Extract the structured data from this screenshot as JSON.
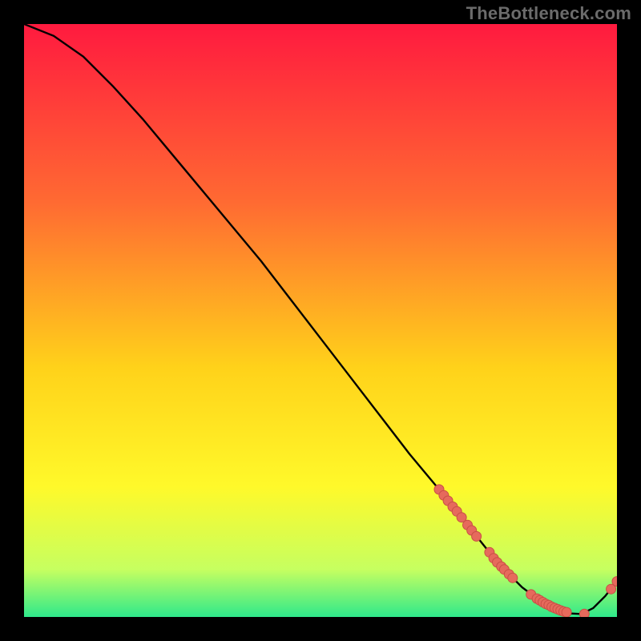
{
  "watermark": "TheBottleneck.com",
  "colors": {
    "background": "#000000",
    "grad_top": "#ff1a3f",
    "grad_mid1": "#ff6a32",
    "grad_mid2": "#ffd21a",
    "grad_mid3": "#fff92a",
    "grad_bottom1": "#c6ff60",
    "grad_bottom2": "#2fe98b",
    "curve": "#000000",
    "marker_fill": "#e66a5c",
    "marker_stroke": "#c94f45"
  },
  "chart_data": {
    "type": "line",
    "title": "",
    "xlabel": "",
    "ylabel": "",
    "xlim": [
      0,
      100
    ],
    "ylim": [
      0,
      100
    ],
    "grid": false,
    "legend": false,
    "series": [
      {
        "name": "curve",
        "x": [
          0,
          5,
          10,
          15,
          20,
          25,
          30,
          35,
          40,
          45,
          50,
          55,
          60,
          65,
          70,
          72,
          74,
          76,
          78,
          80,
          82,
          84,
          86,
          88,
          90,
          92,
          94,
          96,
          98,
          100
        ],
        "y": [
          100,
          98,
          94.5,
          89.5,
          84,
          78,
          72,
          66,
          60,
          53.5,
          47,
          40.5,
          34,
          27.5,
          21.5,
          19,
          16.5,
          14,
          11.5,
          9,
          7,
          5,
          3.5,
          2.2,
          1.2,
          0.6,
          0.5,
          1.5,
          3.5,
          6
        ]
      }
    ],
    "markers": [
      {
        "x": 70.0,
        "y": 21.5
      },
      {
        "x": 70.8,
        "y": 20.5
      },
      {
        "x": 71.5,
        "y": 19.6
      },
      {
        "x": 72.3,
        "y": 18.6
      },
      {
        "x": 73.0,
        "y": 17.8
      },
      {
        "x": 73.8,
        "y": 16.8
      },
      {
        "x": 74.8,
        "y": 15.5
      },
      {
        "x": 75.5,
        "y": 14.6
      },
      {
        "x": 76.3,
        "y": 13.6
      },
      {
        "x": 78.5,
        "y": 10.9
      },
      {
        "x": 79.2,
        "y": 9.9
      },
      {
        "x": 79.8,
        "y": 9.2
      },
      {
        "x": 80.5,
        "y": 8.5
      },
      {
        "x": 81.0,
        "y": 8.0
      },
      {
        "x": 81.8,
        "y": 7.2
      },
      {
        "x": 82.4,
        "y": 6.6
      },
      {
        "x": 85.5,
        "y": 3.8
      },
      {
        "x": 86.5,
        "y": 3.1
      },
      {
        "x": 87.0,
        "y": 2.8
      },
      {
        "x": 87.5,
        "y": 2.5
      },
      {
        "x": 88.0,
        "y": 2.2
      },
      {
        "x": 88.5,
        "y": 2.0
      },
      {
        "x": 89.0,
        "y": 1.7
      },
      {
        "x": 89.5,
        "y": 1.5
      },
      {
        "x": 90.0,
        "y": 1.3
      },
      {
        "x": 90.5,
        "y": 1.1
      },
      {
        "x": 91.0,
        "y": 0.9
      },
      {
        "x": 91.5,
        "y": 0.8
      },
      {
        "x": 94.5,
        "y": 0.5
      },
      {
        "x": 99.0,
        "y": 4.7
      },
      {
        "x": 100.0,
        "y": 6.0
      }
    ]
  }
}
